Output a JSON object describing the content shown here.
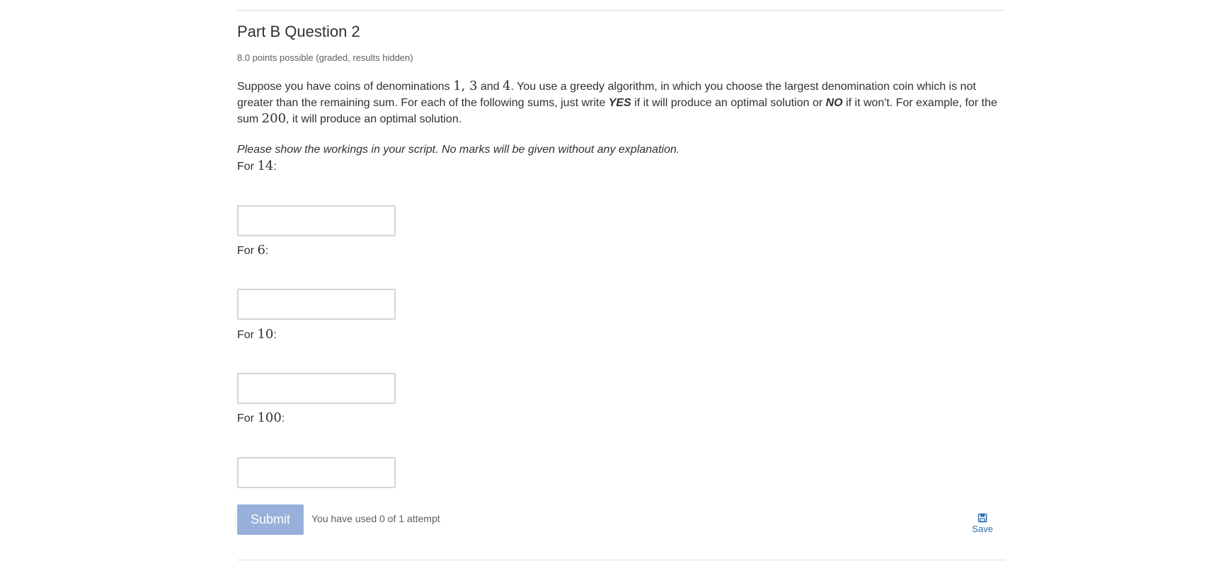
{
  "question": {
    "title": "Part B Question 2",
    "points_text": "8.0 points possible (graded, results hidden)",
    "problem": {
      "t1": "Suppose you have coins of denominations ",
      "m1": "1, 3",
      "t2": " and ",
      "m2": "4",
      "t3": ". You use a greedy algorithm, in which you choose the largest denomination coin which is not greater than the remaining sum. For each of the following sums, just write ",
      "yes": "YES",
      "t4": " if it will produce an optimal solution or ",
      "no": "NO",
      "t5": " if it won't. For example, for the sum ",
      "m3": "200",
      "t6": ", it will produce an optimal solution."
    },
    "instruction": "Please show the workings in your script. No marks will be given without any explanation.",
    "parts": [
      {
        "prefix": "For ",
        "value": "14",
        "suffix": ":",
        "answer": ""
      },
      {
        "prefix": "For ",
        "value": "6",
        "suffix": ":",
        "answer": ""
      },
      {
        "prefix": "For ",
        "value": "10",
        "suffix": ":",
        "answer": ""
      },
      {
        "prefix": "For ",
        "value": "100",
        "suffix": ":",
        "answer": ""
      }
    ]
  },
  "actions": {
    "submit_label": "Submit",
    "attempts_text": "You have used 0 of 1 attempt",
    "save_label": "Save",
    "save_icon": "floppy-disk-icon",
    "submit_color": "#98b1da",
    "link_color": "#2a6fb0"
  }
}
